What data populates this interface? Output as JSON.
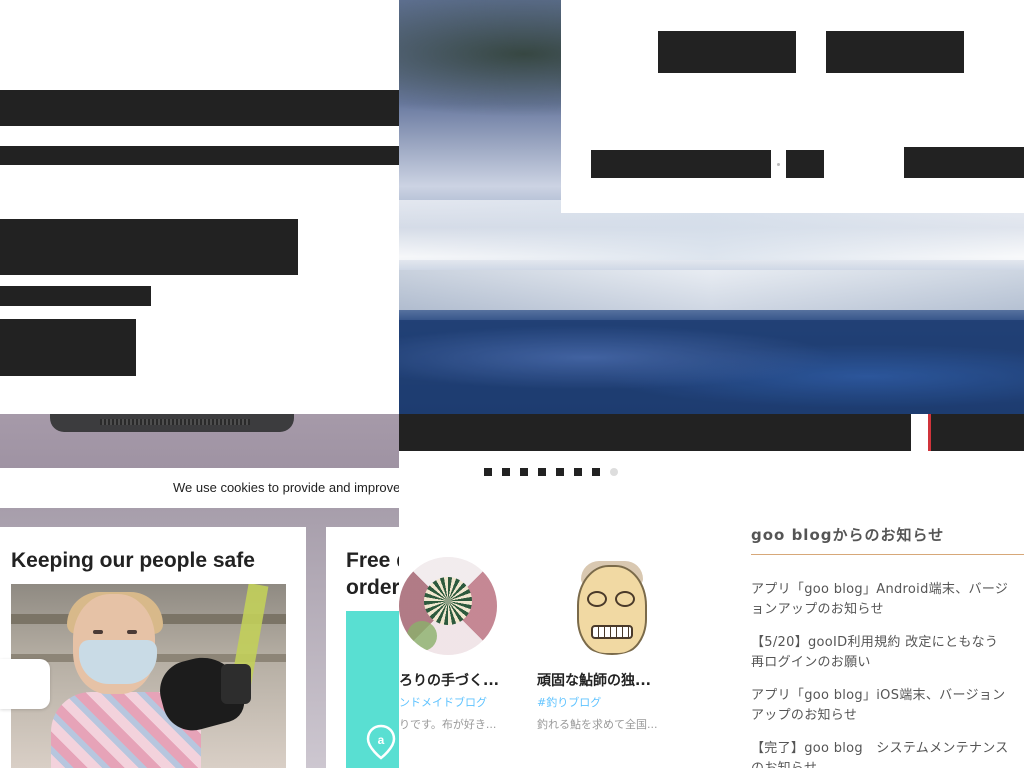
{
  "left_window": {
    "cookie_text": "We use cookies to provide and improve",
    "cards": {
      "safe_title": "Keeping our people safe",
      "free_title_line1": "Free d",
      "free_title_line2": "order"
    }
  },
  "right_window": {
    "carousel": {
      "dots_total": 8,
      "active_dots": 7
    },
    "blogs": [
      {
        "title": "ろりの手づく...",
        "tag": "ンドメイドブログ",
        "desc": "りです。布が好き..."
      },
      {
        "title": "頑固な鮎師の独...",
        "tag": "#釣りブログ",
        "desc": "釣れる鮎を求めて全国..."
      }
    ],
    "notices": {
      "title": "goo blogからのお知らせ",
      "items": [
        "アプリ「goo blog」Android端末、バージョンアップのお知らせ",
        "【5/20】gooID利用規約 改定にともなう再ログインのお願い",
        "アプリ「goo blog」iOS端末、バージョンアップのお知らせ",
        "【完了】goo blog　システムメンテナンスのお知らせ"
      ]
    }
  },
  "colors": {
    "redaction": "#222222",
    "teal_panel": "#59dfd2",
    "link_blue": "#5fc3ff",
    "notice_rule": "#d7a879",
    "accent_red": "#d0343b"
  }
}
